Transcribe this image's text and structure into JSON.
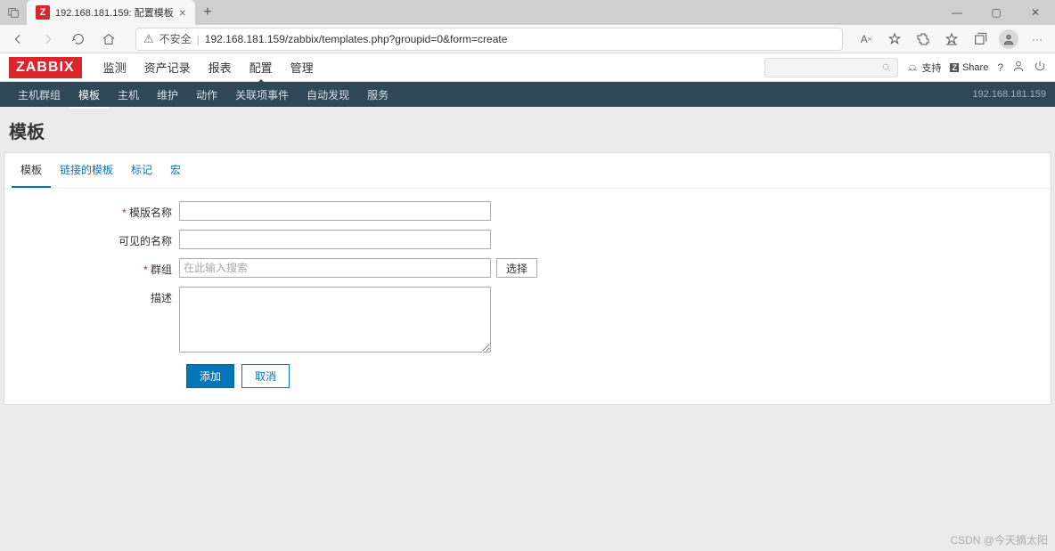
{
  "browser": {
    "tab_title": "192.168.181.159: 配置模板",
    "insecure_label": "不安全",
    "url": "192.168.181.159/zabbix/templates.php?groupid=0&form=create"
  },
  "header": {
    "logo": "ZABBIX",
    "nav": [
      "监测",
      "资产记录",
      "报表",
      "配置",
      "管理"
    ],
    "nav_active": "配置",
    "support": "支持",
    "share": "Share"
  },
  "subnav": {
    "items": [
      "主机群组",
      "模板",
      "主机",
      "维护",
      "动作",
      "关联项事件",
      "自动发现",
      "服务"
    ],
    "active": "模板",
    "ip": "192.168.181.159"
  },
  "page": {
    "title": "模板",
    "tabs": [
      "模板",
      "链接的模板",
      "标记",
      "宏"
    ],
    "tabs_active": "模板",
    "form": {
      "name_label": "模版名称",
      "visible_name_label": "可见的名称",
      "groups_label": "群组",
      "groups_placeholder": "在此输入搜索",
      "groups_select": "选择",
      "description_label": "描述",
      "submit": "添加",
      "cancel": "取消"
    }
  },
  "watermark": "CSDN @今天摘太阳"
}
